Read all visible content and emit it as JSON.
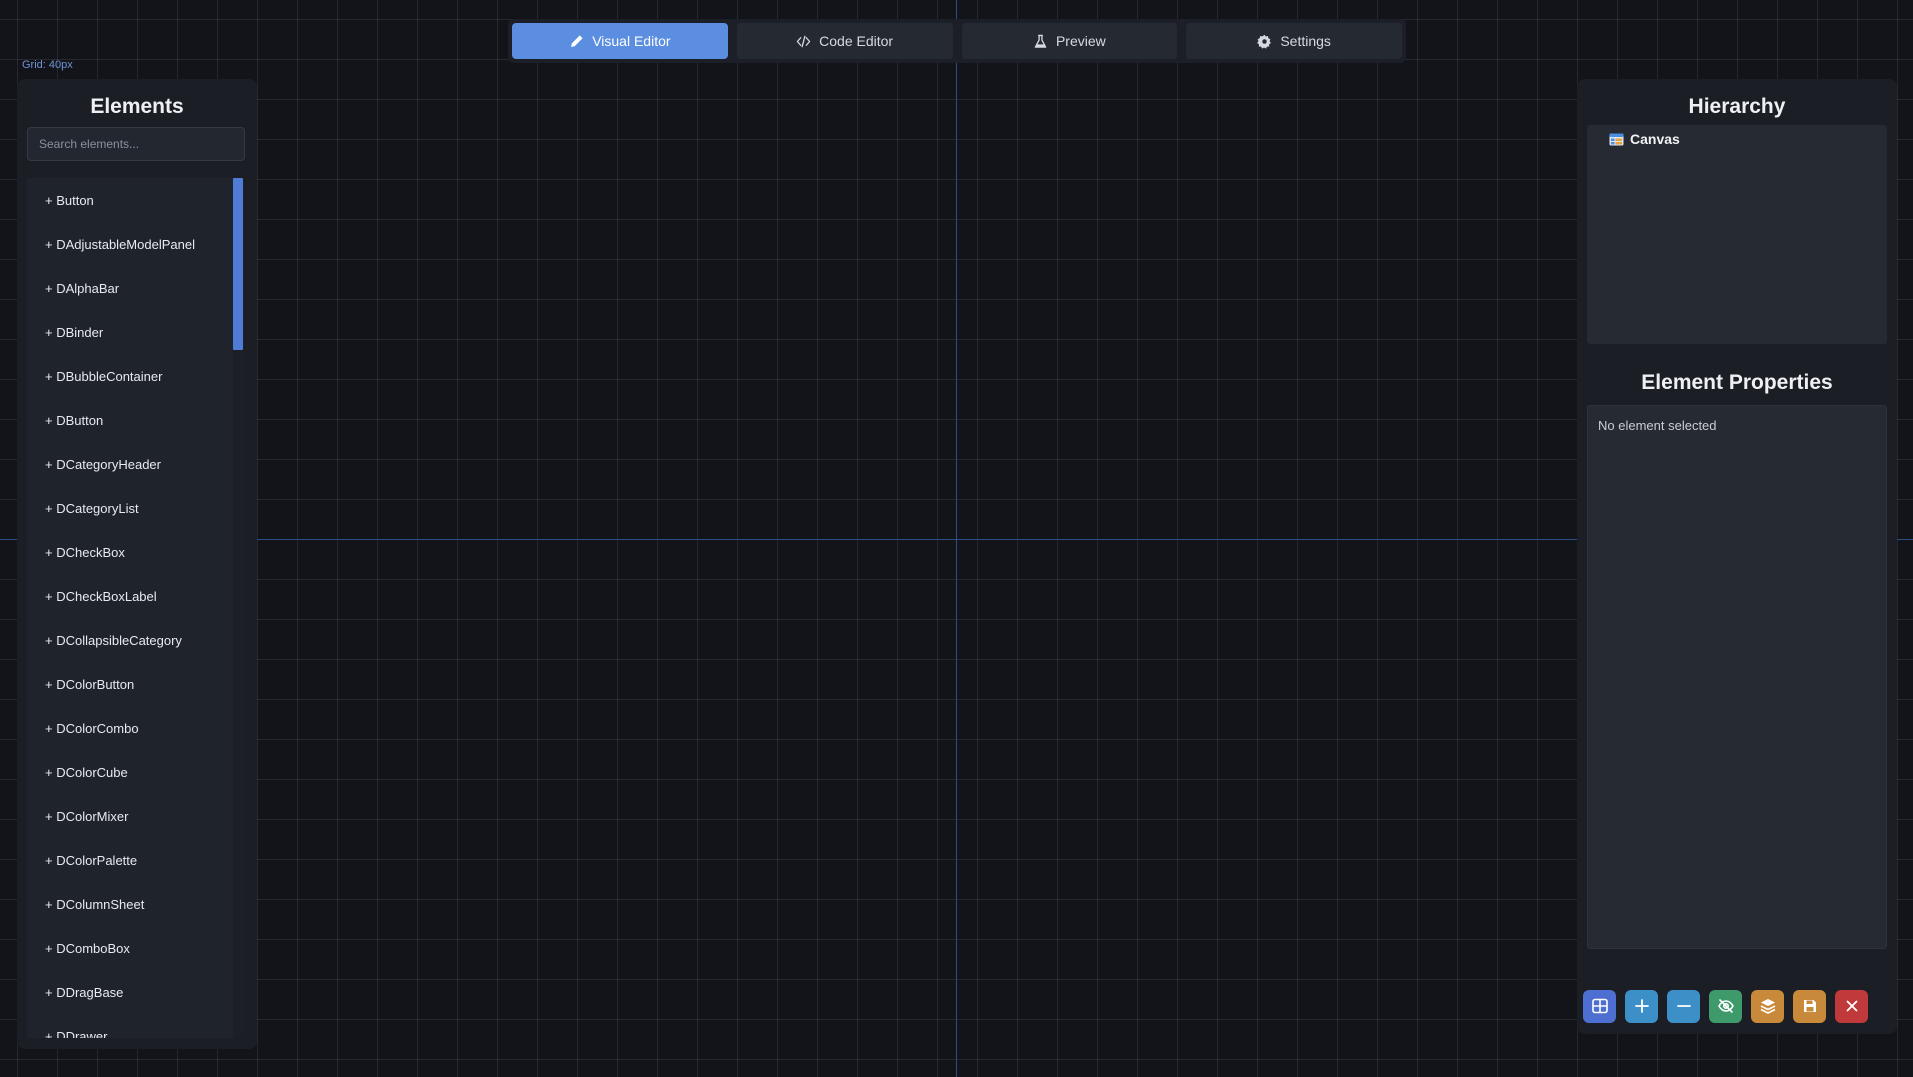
{
  "canvas": {
    "grid_label": "Grid: 40px"
  },
  "tabs": [
    {
      "label": "Visual Editor",
      "icon": "pencil-icon",
      "active": true
    },
    {
      "label": "Code Editor",
      "icon": "code-icon",
      "active": false
    },
    {
      "label": "Preview",
      "icon": "flask-icon",
      "active": false
    },
    {
      "label": "Settings",
      "icon": "gear-icon",
      "active": false
    }
  ],
  "elements_panel": {
    "title": "Elements",
    "search_placeholder": "Search elements...",
    "items": [
      "+ Button",
      "+ DAdjustableModelPanel",
      "+ DAlphaBar",
      "+ DBinder",
      "+ DBubbleContainer",
      "+ DButton",
      "+ DCategoryHeader",
      "+ DCategoryList",
      "+ DCheckBox",
      "+ DCheckBoxLabel",
      "+ DCollapsibleCategory",
      "+ DColorButton",
      "+ DColorCombo",
      "+ DColorCube",
      "+ DColorMixer",
      "+ DColorPalette",
      "+ DColumnSheet",
      "+ DComboBox",
      "+ DDragBase",
      "+ DDrawer"
    ]
  },
  "hierarchy_panel": {
    "title": "Hierarchy",
    "root": {
      "label": "Canvas",
      "icon": "table-icon"
    }
  },
  "properties_panel": {
    "title": "Element Properties",
    "empty_text": "No element selected"
  },
  "toolbar": {
    "buttons": [
      {
        "icon": "grid-icon",
        "color": "#4d6fd1"
      },
      {
        "icon": "plus-icon",
        "color": "#3d8fc7"
      },
      {
        "icon": "minus-icon",
        "color": "#3d8fc7"
      },
      {
        "icon": "eye-off-icon",
        "color": "#3f9a6b"
      },
      {
        "icon": "layers-icon",
        "color": "#c8893a"
      },
      {
        "icon": "save-icon",
        "color": "#c8893a"
      },
      {
        "icon": "close-icon",
        "color": "#c0393b"
      }
    ]
  },
  "colors": {
    "accent": "#5b8ee0",
    "background": "#12141a",
    "panel": "#1b1e25"
  }
}
